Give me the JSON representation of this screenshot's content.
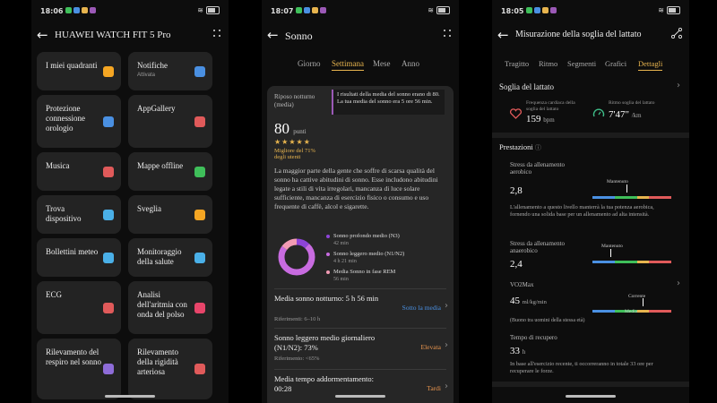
{
  "p1": {
    "status": {
      "time": "18:06"
    },
    "title": "HUAWEI WATCH FIT 5 Pro",
    "cards": [
      {
        "label": "I miei quadranti",
        "sub": "",
        "icon": "watch-face-icon",
        "color": "#f5a623"
      },
      {
        "label": "Notifiche",
        "sub": "Attivata",
        "icon": "mail-icon",
        "color": "#4a90e2"
      },
      {
        "label": "Protezione connessione orologio",
        "sub": "",
        "icon": "laptop-icon",
        "color": "#4a90e2"
      },
      {
        "label": "AppGallery",
        "sub": "",
        "icon": "appgallery-icon",
        "color": "#e05a5a"
      },
      {
        "label": "Musica",
        "sub": "",
        "icon": "music-icon",
        "color": "#e05a5a"
      },
      {
        "label": "Mappe offline",
        "sub": "",
        "icon": "map-icon",
        "color": "#3fbf5a"
      },
      {
        "label": "Trova dispositivo",
        "sub": "",
        "icon": "find-device-icon",
        "color": "#4ab0e8"
      },
      {
        "label": "Sveglia",
        "sub": "",
        "icon": "alarm-icon",
        "color": "#f5a623"
      },
      {
        "label": "Bollettini meteo",
        "sub": "",
        "icon": "weather-icon",
        "color": "#4ab0e8"
      },
      {
        "label": "Monitoraggio della salute",
        "sub": "",
        "icon": "health-monitor-icon",
        "color": "#4ab0e8"
      },
      {
        "label": "ECG",
        "sub": "",
        "icon": "ecg-icon",
        "color": "#e05a5a"
      },
      {
        "label": "Analisi dell'aritmia con onda del polso",
        "sub": "",
        "icon": "heart-icon",
        "color": "#e8456a"
      },
      {
        "label": "Rilevamento del respiro nel sonno",
        "sub": "",
        "icon": "sleep-breath-icon",
        "color": "#8e6cd8"
      },
      {
        "label": "Rilevamento della rigidità arteriosa",
        "sub": "",
        "icon": "artery-icon",
        "color": "#e05a5a"
      }
    ]
  },
  "p2": {
    "status": {
      "time": "18:07"
    },
    "title": "Sonno",
    "tabs": [
      "Giorno",
      "Settimana",
      "Mese",
      "Anno"
    ],
    "active_tab": "Settimana",
    "rest_label": "Riposo notturno (media)",
    "score": "80",
    "score_unit": "punti",
    "stars": "★★★★★",
    "better_than": "Migliore del 71% degli utenti",
    "tooltip": "I risultati della media del sonno erano di 80. La tua media del sonno era 5 ore 56 min.",
    "paragraph": "La maggior parte della gente che soffre di scarsa qualità del sonno ha cattive abitudini di sonno. Esse includono abitudini legate a stili di vita irregolari, mancanza di luce solare sufficiente, mancanza di esercizio fisico o consumo e uso frequente di caffè, alcol e sigarette.",
    "legend": [
      {
        "label": "Sonno profondo medio (N3)",
        "value": "42 min",
        "color": "#8e44d8",
        "fraction": 0.12
      },
      {
        "label": "Sonno leggero medio (N1/N2)",
        "value": "4 h 21 min",
        "color": "#c86be0",
        "fraction": 0.73
      },
      {
        "label": "Media Sonno in fase REM",
        "value": "56 min",
        "color": "#f29bb4",
        "fraction": 0.15
      }
    ],
    "metrics": [
      {
        "title": "Media sonno notturno: 5 h 56 min",
        "ref": "Riferimenti: 6–10 h",
        "status": "Sotto la media",
        "status_color": "#4a90e2"
      },
      {
        "title": "Sonno leggero medio giornaliero (N1/N2): 73%",
        "ref": "Riferimento: <65%",
        "status": "Elevata",
        "status_color": "#e7944e"
      },
      {
        "title": "Media tempo addormentamento: 00:28",
        "ref": "",
        "status": "Tardi",
        "status_color": "#e7944e"
      }
    ]
  },
  "p3": {
    "status": {
      "time": "18:05"
    },
    "title": "Misurazione della soglia del lattato",
    "tabs": [
      "Tragitto",
      "Ritmo",
      "Segmenti",
      "Grafici",
      "Dettagli"
    ],
    "active_tab": "Dettagli",
    "lactate_title": "Soglia del lattato",
    "hr_label": "Frequenza cardiaca della soglia del lattato",
    "hr_value": "159",
    "hr_unit": "bpm",
    "pace_label": "Ritmo soglia del lattato",
    "pace_value": "7'47\"",
    "pace_unit": "/km",
    "perf_title": "Prestazioni",
    "aerobic_label": "Stress da allenamento aerobico",
    "aerobic_value": "2,8",
    "aerobic_marker": "Mantenuto",
    "aerobic_desc": "L'allenamento a questo livello manterrà la tua potenza aerobica, fornendo una solida base per un allenamento ad alta intensità.",
    "anaerobic_label": "Stress da allenamento anaerobico",
    "anaerobic_value": "2,4",
    "anaerobic_marker": "Mantenuto",
    "vo2_label": "VO2Max",
    "vo2_value": "45",
    "vo2_unit": "ml/kg/min",
    "vo2_marker_top": "Corrente",
    "vo2_marker_bottom": "Media",
    "vo2_note": "(Buono tra uomini della stessa età)",
    "recovery_label": "Tempo di recupero",
    "recovery_value": "33",
    "recovery_unit": "h",
    "recovery_desc": "In base all'esercizio recente, ti occorreranno in totale 33 ore per recuperare le forze."
  }
}
